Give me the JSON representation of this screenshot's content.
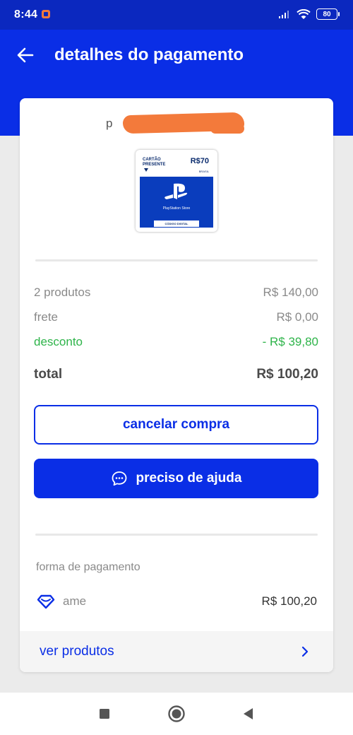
{
  "status_bar": {
    "time": "8:44",
    "battery": "80"
  },
  "app_bar": {
    "title": "detalhes do pagamento"
  },
  "order": {
    "seller_fragment": "p",
    "gift_card": {
      "label": "CARTÃO PRESENTE",
      "value": "R$70",
      "country": "BRASIL",
      "store": "PlayStation Store",
      "code_label": "CÓDIGO DIGITAL"
    }
  },
  "summary": {
    "products": {
      "label": "2 produtos",
      "value": "R$ 140,00"
    },
    "shipping": {
      "label": "frete",
      "value": "R$ 0,00"
    },
    "discount": {
      "label": "desconto",
      "value": "- R$ 39,80"
    },
    "total": {
      "label": "total",
      "value": "R$ 100,20"
    }
  },
  "actions": {
    "cancel_label": "cancelar compra",
    "help_label": "preciso de ajuda"
  },
  "payment": {
    "section_label": "forma de pagamento",
    "method": "ame",
    "amount": "R$ 100,20"
  },
  "footer": {
    "link_label": "ver produtos"
  },
  "colors": {
    "brand_blue": "#0a2ee6",
    "discount_green": "#2eb44a",
    "redaction_orange": "#f37a3b"
  },
  "icons": {
    "back": "arrow-left-icon",
    "help": "chat-bubble-icon",
    "payment": "ame-heart-icon",
    "footer": "chevron-right-icon",
    "nav_recents": "square-icon",
    "nav_home": "circle-icon",
    "nav_back": "triangle-back-icon"
  }
}
